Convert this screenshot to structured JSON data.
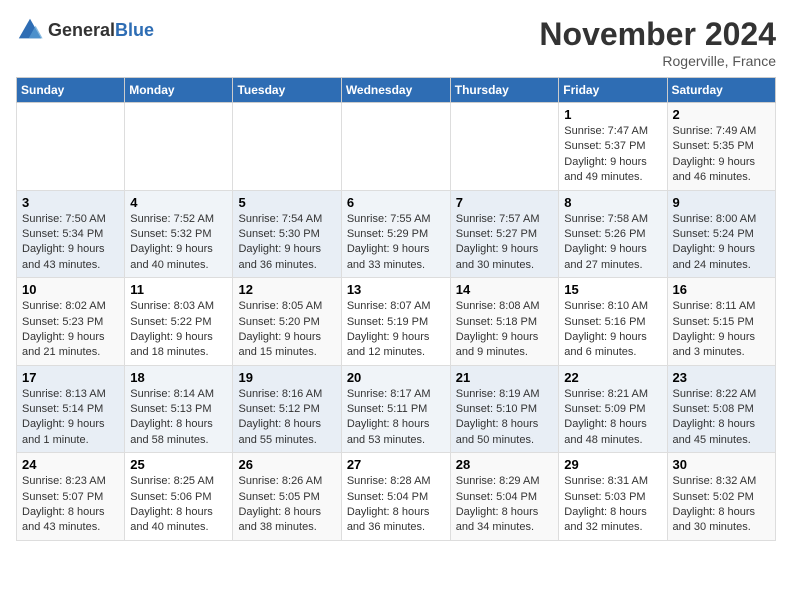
{
  "header": {
    "logo_general": "General",
    "logo_blue": "Blue",
    "title": "November 2024",
    "location": "Rogerville, France"
  },
  "days_of_week": [
    "Sunday",
    "Monday",
    "Tuesday",
    "Wednesday",
    "Thursday",
    "Friday",
    "Saturday"
  ],
  "weeks": [
    [
      {
        "day": "",
        "info": ""
      },
      {
        "day": "",
        "info": ""
      },
      {
        "day": "",
        "info": ""
      },
      {
        "day": "",
        "info": ""
      },
      {
        "day": "",
        "info": ""
      },
      {
        "day": "1",
        "info": "Sunrise: 7:47 AM\nSunset: 5:37 PM\nDaylight: 9 hours and 49 minutes."
      },
      {
        "day": "2",
        "info": "Sunrise: 7:49 AM\nSunset: 5:35 PM\nDaylight: 9 hours and 46 minutes."
      }
    ],
    [
      {
        "day": "3",
        "info": "Sunrise: 7:50 AM\nSunset: 5:34 PM\nDaylight: 9 hours and 43 minutes."
      },
      {
        "day": "4",
        "info": "Sunrise: 7:52 AM\nSunset: 5:32 PM\nDaylight: 9 hours and 40 minutes."
      },
      {
        "day": "5",
        "info": "Sunrise: 7:54 AM\nSunset: 5:30 PM\nDaylight: 9 hours and 36 minutes."
      },
      {
        "day": "6",
        "info": "Sunrise: 7:55 AM\nSunset: 5:29 PM\nDaylight: 9 hours and 33 minutes."
      },
      {
        "day": "7",
        "info": "Sunrise: 7:57 AM\nSunset: 5:27 PM\nDaylight: 9 hours and 30 minutes."
      },
      {
        "day": "8",
        "info": "Sunrise: 7:58 AM\nSunset: 5:26 PM\nDaylight: 9 hours and 27 minutes."
      },
      {
        "day": "9",
        "info": "Sunrise: 8:00 AM\nSunset: 5:24 PM\nDaylight: 9 hours and 24 minutes."
      }
    ],
    [
      {
        "day": "10",
        "info": "Sunrise: 8:02 AM\nSunset: 5:23 PM\nDaylight: 9 hours and 21 minutes."
      },
      {
        "day": "11",
        "info": "Sunrise: 8:03 AM\nSunset: 5:22 PM\nDaylight: 9 hours and 18 minutes."
      },
      {
        "day": "12",
        "info": "Sunrise: 8:05 AM\nSunset: 5:20 PM\nDaylight: 9 hours and 15 minutes."
      },
      {
        "day": "13",
        "info": "Sunrise: 8:07 AM\nSunset: 5:19 PM\nDaylight: 9 hours and 12 minutes."
      },
      {
        "day": "14",
        "info": "Sunrise: 8:08 AM\nSunset: 5:18 PM\nDaylight: 9 hours and 9 minutes."
      },
      {
        "day": "15",
        "info": "Sunrise: 8:10 AM\nSunset: 5:16 PM\nDaylight: 9 hours and 6 minutes."
      },
      {
        "day": "16",
        "info": "Sunrise: 8:11 AM\nSunset: 5:15 PM\nDaylight: 9 hours and 3 minutes."
      }
    ],
    [
      {
        "day": "17",
        "info": "Sunrise: 8:13 AM\nSunset: 5:14 PM\nDaylight: 9 hours and 1 minute."
      },
      {
        "day": "18",
        "info": "Sunrise: 8:14 AM\nSunset: 5:13 PM\nDaylight: 8 hours and 58 minutes."
      },
      {
        "day": "19",
        "info": "Sunrise: 8:16 AM\nSunset: 5:12 PM\nDaylight: 8 hours and 55 minutes."
      },
      {
        "day": "20",
        "info": "Sunrise: 8:17 AM\nSunset: 5:11 PM\nDaylight: 8 hours and 53 minutes."
      },
      {
        "day": "21",
        "info": "Sunrise: 8:19 AM\nSunset: 5:10 PM\nDaylight: 8 hours and 50 minutes."
      },
      {
        "day": "22",
        "info": "Sunrise: 8:21 AM\nSunset: 5:09 PM\nDaylight: 8 hours and 48 minutes."
      },
      {
        "day": "23",
        "info": "Sunrise: 8:22 AM\nSunset: 5:08 PM\nDaylight: 8 hours and 45 minutes."
      }
    ],
    [
      {
        "day": "24",
        "info": "Sunrise: 8:23 AM\nSunset: 5:07 PM\nDaylight: 8 hours and 43 minutes."
      },
      {
        "day": "25",
        "info": "Sunrise: 8:25 AM\nSunset: 5:06 PM\nDaylight: 8 hours and 40 minutes."
      },
      {
        "day": "26",
        "info": "Sunrise: 8:26 AM\nSunset: 5:05 PM\nDaylight: 8 hours and 38 minutes."
      },
      {
        "day": "27",
        "info": "Sunrise: 8:28 AM\nSunset: 5:04 PM\nDaylight: 8 hours and 36 minutes."
      },
      {
        "day": "28",
        "info": "Sunrise: 8:29 AM\nSunset: 5:04 PM\nDaylight: 8 hours and 34 minutes."
      },
      {
        "day": "29",
        "info": "Sunrise: 8:31 AM\nSunset: 5:03 PM\nDaylight: 8 hours and 32 minutes."
      },
      {
        "day": "30",
        "info": "Sunrise: 8:32 AM\nSunset: 5:02 PM\nDaylight: 8 hours and 30 minutes."
      }
    ]
  ]
}
